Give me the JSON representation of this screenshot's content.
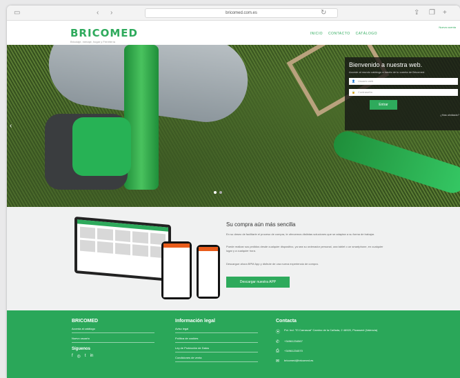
{
  "browser": {
    "address": "bricomed.com.es"
  },
  "header": {
    "logo": "BRICOMED",
    "tagline": "Bricolaje, menaje, hogar y Ferretería",
    "nav": [
      "INICIO",
      "CONTACTO",
      "CATÁLOGO"
    ],
    "top_link": "Nueva cuenta"
  },
  "login": {
    "title": "Bienvenido a nuestra web.",
    "subtitle": "Accede al mundo catálogo a través de tu cuenta de Bricomed.",
    "user_placeholder": "Usuario web",
    "pass_placeholder": "Contraseña",
    "enter_label": "Entrar",
    "forgot_label": "¿Has olvidado?"
  },
  "app_section": {
    "title": "Su compra aún más sencilla",
    "para1": "En su deseo de facilitarle el proceso de compra, le ofrecemos distintas soluciones que se adaptan a su forma de trabajar.",
    "para2": "Puede realizar sus pedidos desde cualquier dispositivo, ya sea su ordenador personal, una tablet o un smartphone, en cualquier lugar y a cualquier hora.",
    "para3": "Descargue ahora BPM App y disfrute de una nueva experiencia de compra.",
    "button": "Descargar nuestra APP"
  },
  "footer": {
    "col1": {
      "title": "BRICOMED",
      "items": [
        "Acceda al catálogo",
        "Nuevo usuario"
      ],
      "follow": "Síguenos",
      "social": [
        "f",
        "◎",
        "t",
        "in"
      ]
    },
    "col2": {
      "title": "Información legal",
      "items": [
        "Aviso legal",
        "Política de cookies",
        "Ley de Protección de Datos",
        "Condiciones de venta"
      ]
    },
    "col3": {
      "title": "Contacta",
      "address": "Pol. Ind. \"El Carrascal\" Camino de la Cañada, 2 46920, Picassent (Valencia)",
      "phone": "+34961234567",
      "fax": "+34961234570",
      "email": "bricomed@bricomed.es"
    }
  },
  "colors": {
    "brand": "#2eaa5c",
    "footer": "#2aa759",
    "app_bg": "#f0f1f1"
  }
}
